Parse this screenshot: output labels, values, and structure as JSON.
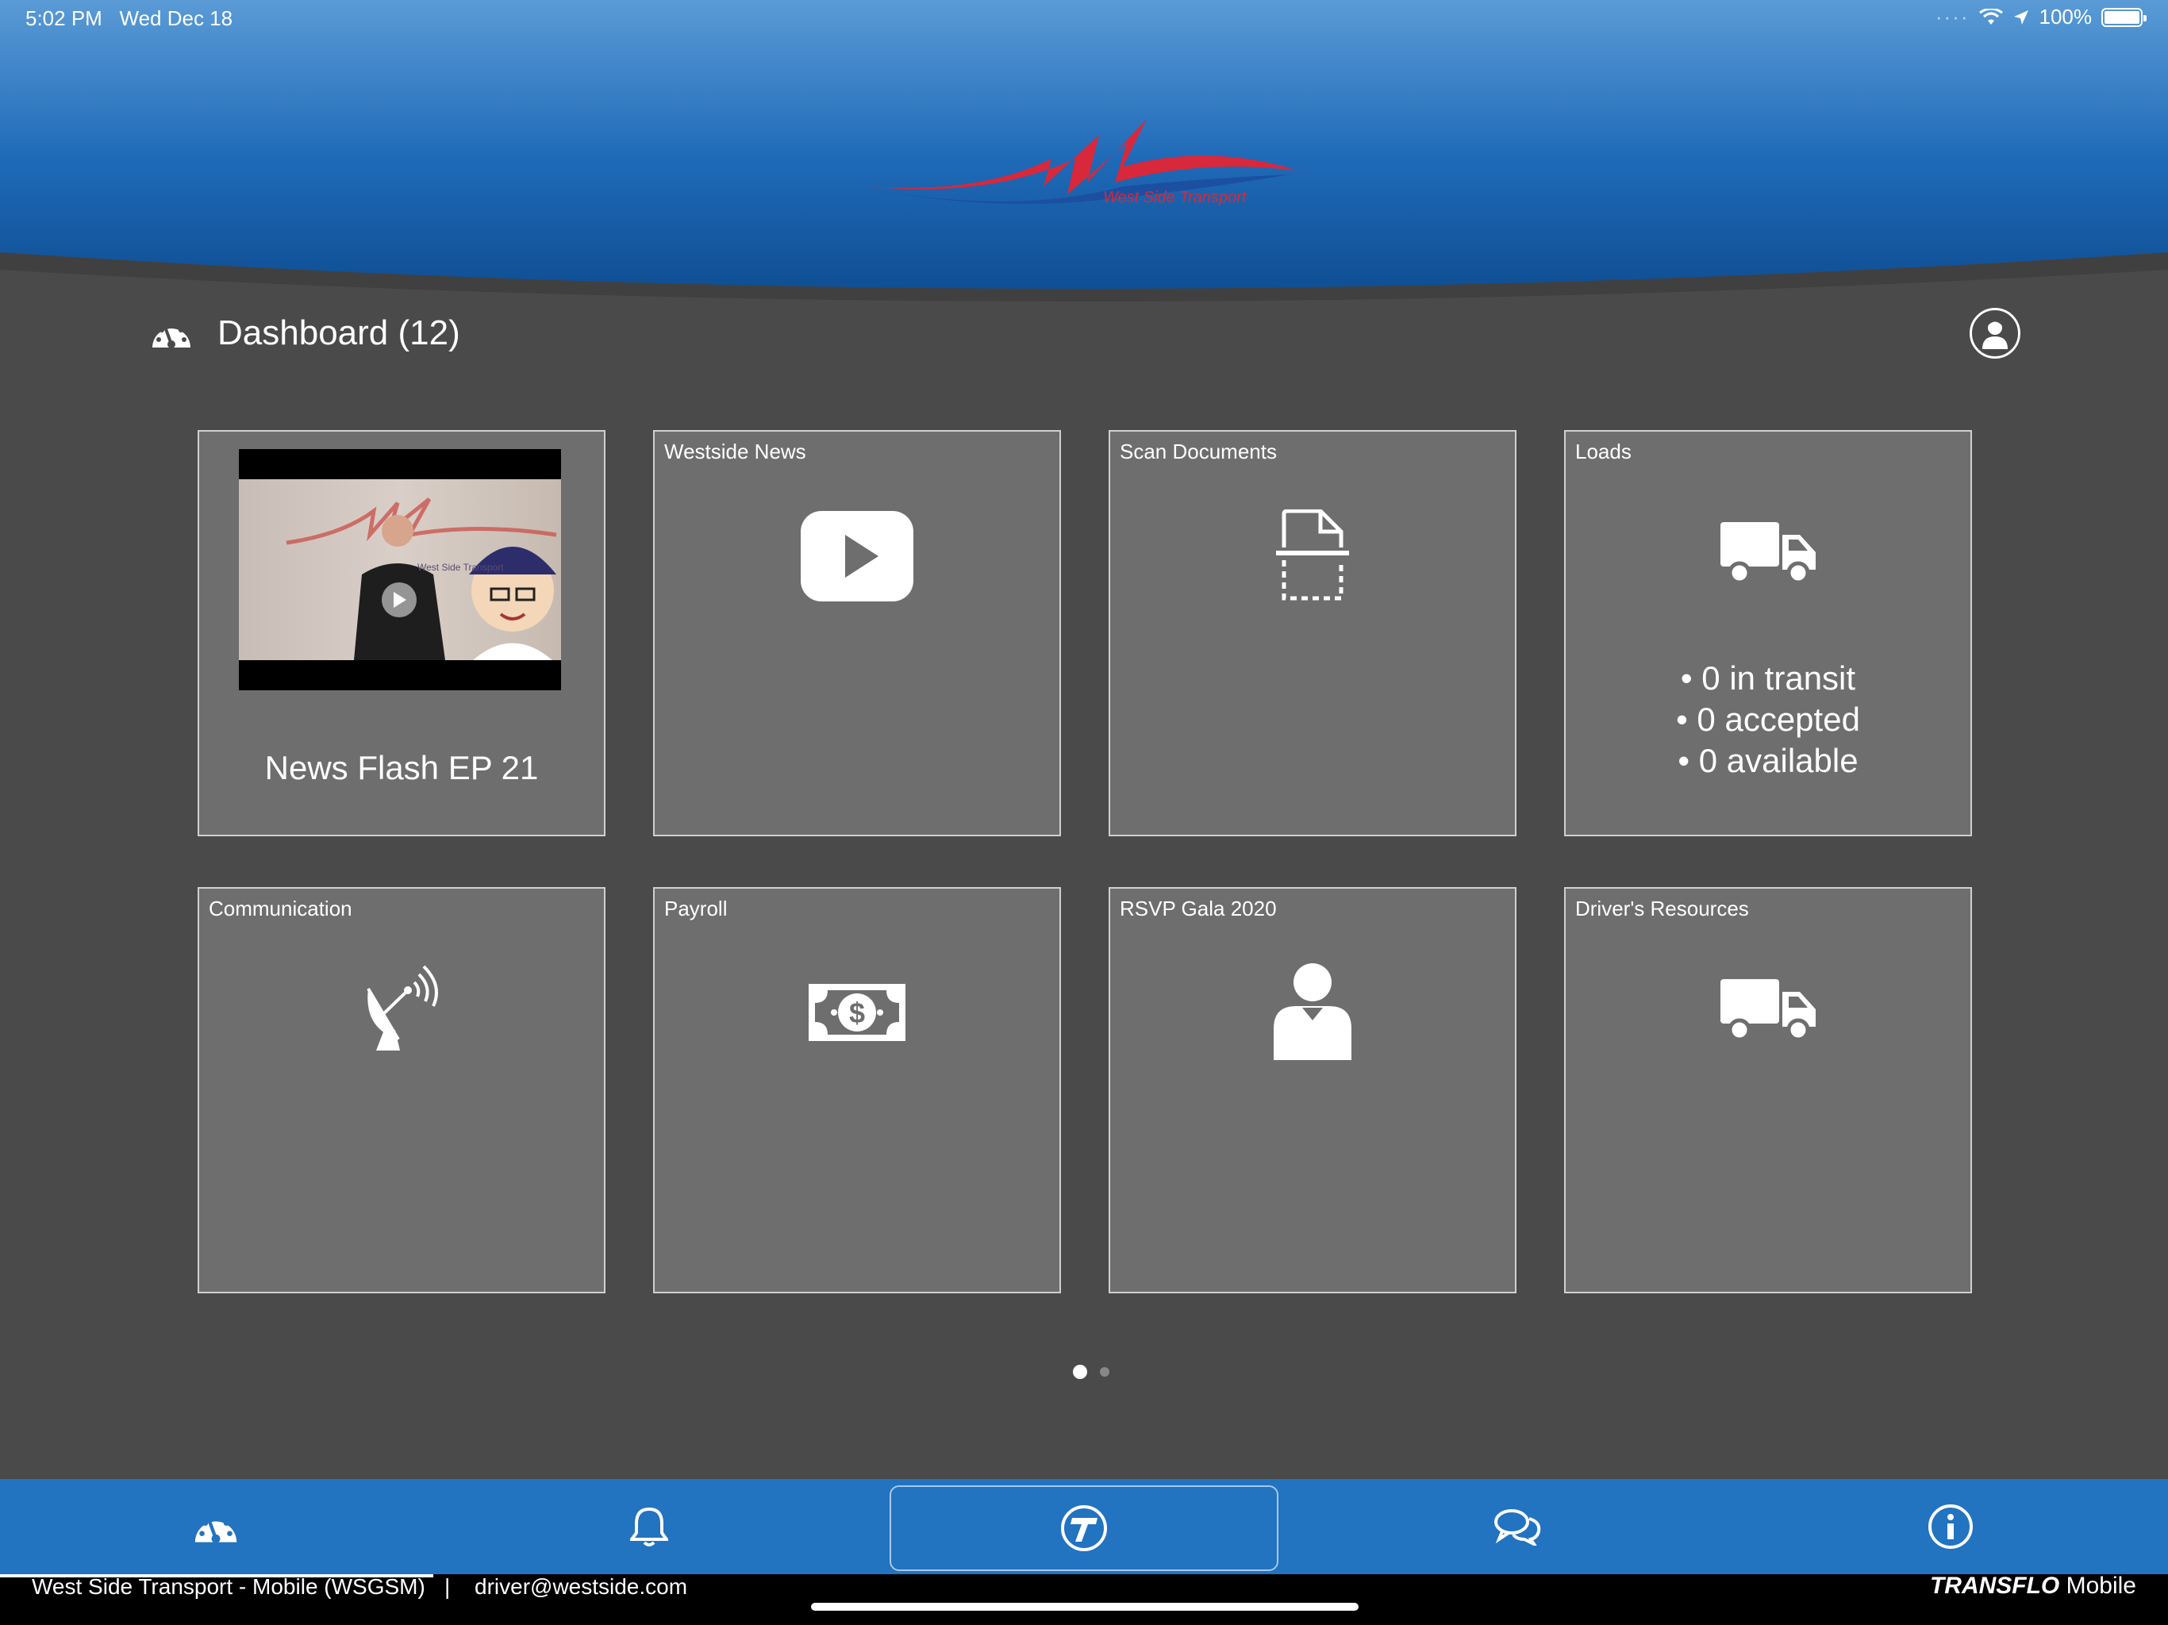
{
  "status_bar": {
    "time": "5:02 PM",
    "date": "Wed Dec 18",
    "battery": "100%"
  },
  "header": {
    "logo_caption": "West Side Transport"
  },
  "dashboard": {
    "title": "Dashboard (12)"
  },
  "tiles": [
    {
      "id": "news-flash",
      "label": "",
      "caption": "News Flash EP 21",
      "thumb_text": "West Side Transport"
    },
    {
      "id": "westside-news",
      "label": "Westside News",
      "icon": "play-icon"
    },
    {
      "id": "scan-documents",
      "label": "Scan Documents",
      "icon": "scan-document-icon"
    },
    {
      "id": "loads",
      "label": "Loads",
      "icon": "truck-icon",
      "stats": [
        "• 0 in transit",
        "• 0 accepted",
        "• 0 available"
      ]
    },
    {
      "id": "communication",
      "label": "Communication",
      "icon": "satellite-dish-icon"
    },
    {
      "id": "payroll",
      "label": "Payroll",
      "icon": "money-bill-icon"
    },
    {
      "id": "rsvp-gala",
      "label": "RSVP Gala 2020",
      "icon": "person-icon"
    },
    {
      "id": "drivers-resources",
      "label": "Driver's Resources",
      "icon": "truck-icon"
    }
  ],
  "pager": {
    "current_page": 1,
    "total_pages": 2
  },
  "tabbar": {
    "tabs": [
      "dashboard-icon",
      "bell-icon",
      "transflo-icon",
      "chat-icon",
      "info-icon"
    ],
    "active": "transflo-icon"
  },
  "footer": {
    "account": "West Side Transport - Mobile (WSGSM)",
    "separator": "|",
    "email": "driver@westside.com",
    "brand": "TRANSFLO",
    "brand_suffix": " Mobile"
  },
  "colors": {
    "header_blue": "#2470c0",
    "tabbar_blue": "#2273c0",
    "background": "#4a4a4a",
    "tile": "#6e6e6e",
    "logo_red": "#d8283b"
  }
}
